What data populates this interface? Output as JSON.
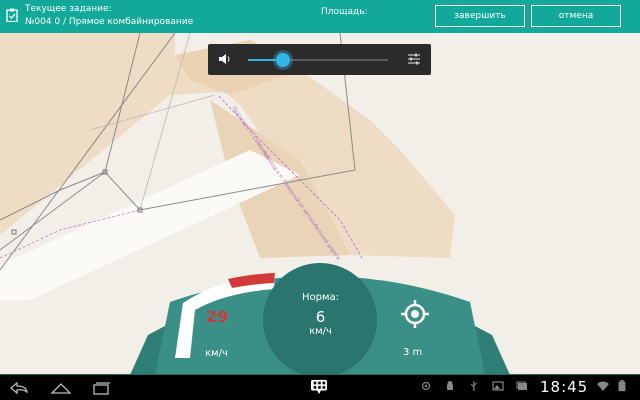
{
  "header": {
    "task_title": "Текущее задание:",
    "task_name": "№004 0 / Прямое комбайнирование",
    "area_label": "Площадь:",
    "finish_label": "завершить",
    "cancel_label": "отмена",
    "background_color": "#12a99a"
  },
  "volume_popup": {
    "level_percent": 25,
    "accent_color": "#33b5e5"
  },
  "map": {
    "road_labels": [
      "Подъезд к п. Северный от автомобильной дороги",
      "Подъезд к п. Северный"
    ]
  },
  "dashboard": {
    "speed_value": "29",
    "speed_unit": "км/ч",
    "speed_arc_percent": 35,
    "norm_label": "Норма:",
    "norm_value": "6",
    "norm_unit": "км/ч",
    "gps_accuracy": "3 m",
    "speed_color": "#d23a3a",
    "panel_color": "#3a8f86"
  },
  "system_bar": {
    "time": "18:45"
  }
}
